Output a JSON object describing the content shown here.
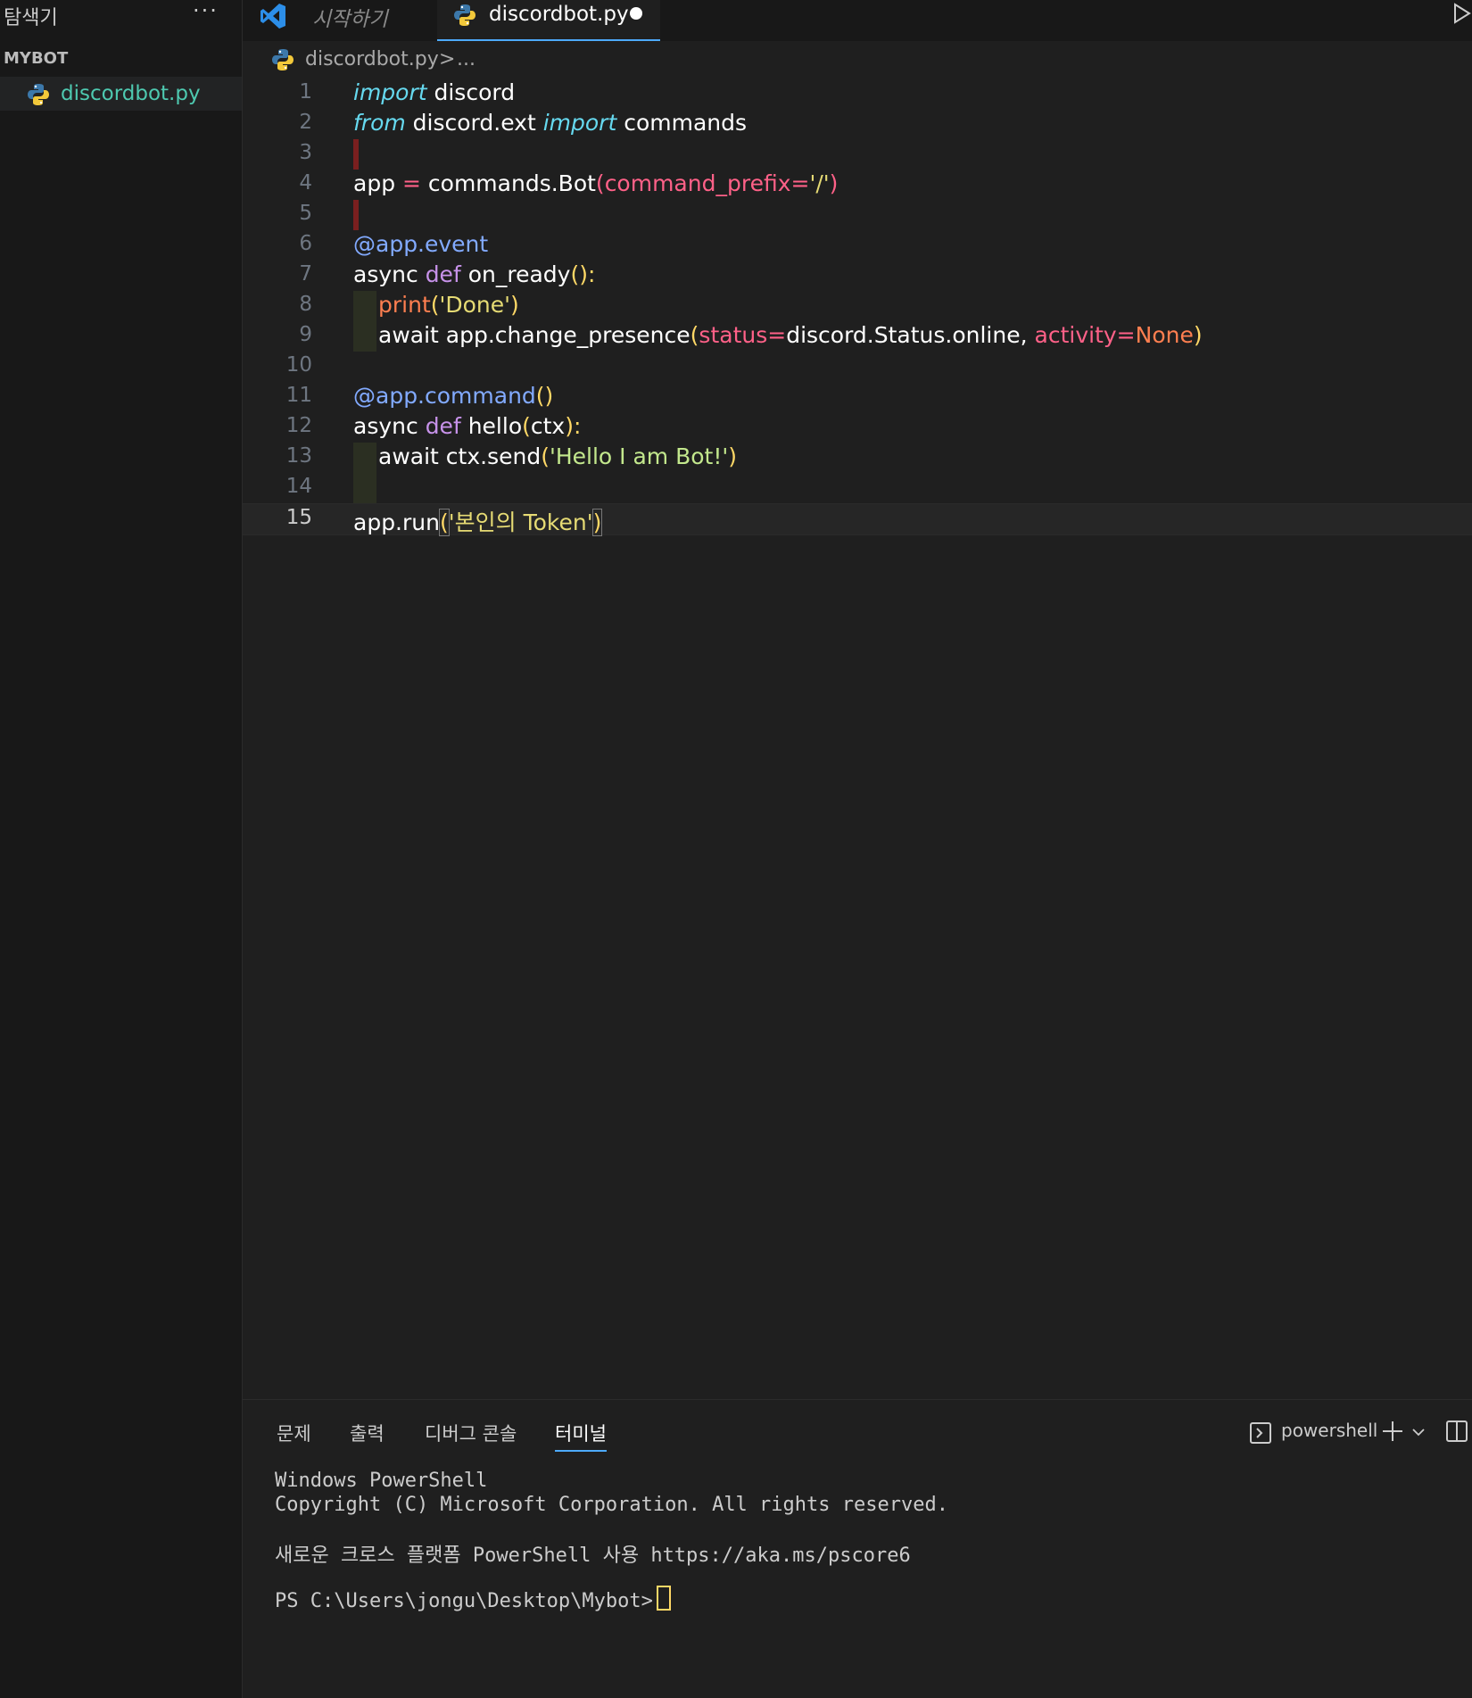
{
  "sidebar": {
    "title": "탐색기",
    "more": "···",
    "section": "MYBOT",
    "file": "discordbot.py"
  },
  "tabs": {
    "welcome": "시작하기",
    "active": "discordbot.py"
  },
  "breadcrumb": {
    "file": "discordbot.py",
    "sep": ">",
    "rest": "..."
  },
  "editor": {
    "line_numbers": [
      "1",
      "2",
      "3",
      "4",
      "5",
      "6",
      "7",
      "8",
      "9",
      "10",
      "11",
      "12",
      "13",
      "14",
      "15"
    ],
    "current_line": 15,
    "tokens": {
      "l1_import": "import",
      "l1_mod": " discord",
      "l2_from": "from",
      "l2_mod": " discord.ext ",
      "l2_import": "import",
      "l2_name": " commands",
      "l4_app": "app ",
      "l4_eq": "=",
      "l4_call": " commands.Bot",
      "l4_paren": "(",
      "l4_kw": "command_prefix",
      "l4_eq2": "=",
      "l4_str": "'/'",
      "l4_close": ")",
      "l6": "@app.event",
      "l7_async": "async ",
      "l7_def": "def",
      "l7_name": " on_ready",
      "l7_paren": "():",
      "l8_print": "print",
      "l8_paren": "(",
      "l8_str": "'Done'",
      "l8_close": ")",
      "l9_await": "await app.change_presence",
      "l9_paren": "(",
      "l9_kw1": "status",
      "l9_eq1": "=",
      "l9_val": "discord.Status.online",
      "l9_comma": ", ",
      "l9_kw2": "activity",
      "l9_eq2": "=",
      "l9_none": "None",
      "l9_close": ")",
      "l11_dec": "@app.command",
      "l11_paren": "()",
      "l12_async": "async ",
      "l12_def": "def",
      "l12_name": " hello",
      "l12_paren": "(",
      "l12_arg": "ctx",
      "l12_close": "):",
      "l13_await": "await ctx.send",
      "l13_paren": "(",
      "l13_str": "'Hello I am Bot!'",
      "l13_close": ")",
      "l15_call": "app.run",
      "l15_paren": "(",
      "l15_str": "'본인의 Token'",
      "l15_close": ")"
    }
  },
  "panel": {
    "tabs": [
      "문제",
      "출력",
      "디버그 콘솔",
      "터미널"
    ],
    "shell": "powershell",
    "terminal": [
      "Windows PowerShell",
      "Copyright (C) Microsoft Corporation. All rights reserved.",
      "새로운 크로스 플랫폼 PowerShell 사용 https://aka.ms/pscore6",
      "PS C:\\Users\\jongu\\Desktop\\Mybot>"
    ]
  },
  "colors": {
    "accent": "#4daafc",
    "background": "#1f1f1f",
    "sidebar": "#181818"
  }
}
